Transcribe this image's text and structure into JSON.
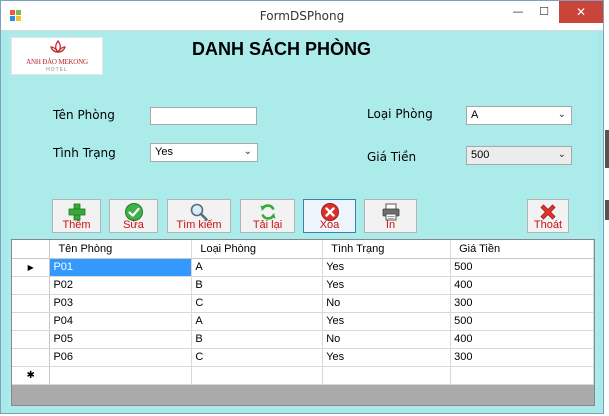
{
  "window": {
    "title": "FormDSPhong",
    "minimize": "—",
    "maximize": "☐",
    "close": "✕"
  },
  "logo": {
    "brand": "ANH ĐÀO MEKONG",
    "sub": "HOTEL"
  },
  "heading": "DANH SÁCH PHÒNG",
  "form": {
    "ten_phong": {
      "label": "Tên Phòng",
      "value": ""
    },
    "tinh_trang": {
      "label": "Tình Trạng",
      "value": "Yes"
    },
    "loai_phong": {
      "label": "Loại Phòng",
      "value": "A"
    },
    "gia_tien": {
      "label": "Giá Tiền",
      "value": "500"
    }
  },
  "toolbar": {
    "them": "Thêm",
    "sua": "Sửa",
    "tim_kiem": "Tìm kiếm",
    "tai_lai": "Tải lại",
    "xoa": "Xóa",
    "in": "In",
    "thoat": "Thoát"
  },
  "grid": {
    "columns": [
      "Tên Phòng",
      "Loại Phòng",
      "Tình Trạng",
      "Giá Tiền"
    ],
    "rows": [
      [
        "P01",
        "A",
        "Yes",
        "500"
      ],
      [
        "P02",
        "B",
        "Yes",
        "400"
      ],
      [
        "P03",
        "C",
        "No",
        "300"
      ],
      [
        "P04",
        "A",
        "Yes",
        "500"
      ],
      [
        "P05",
        "B",
        "No",
        "400"
      ],
      [
        "P06",
        "C",
        "Yes",
        "300"
      ]
    ],
    "current_marker": "▶",
    "new_row_marker": "✱"
  },
  "colors": {
    "form_bg": "#abeceb",
    "caption_red": "#cc1010",
    "selection": "#3399ff",
    "close_button": "#c9453a"
  }
}
